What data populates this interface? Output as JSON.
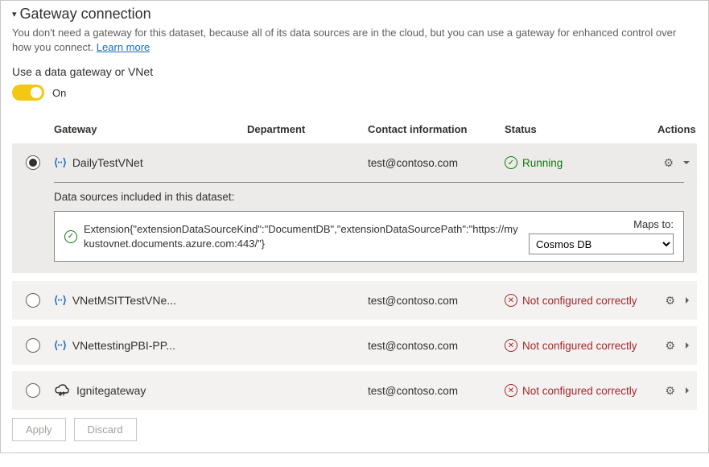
{
  "header": {
    "title": "Gateway connection",
    "description": "You don't need a gateway for this dataset, because all of its data sources are in the cloud, but you can use a gateway for enhanced control over how you connect. ",
    "learn_more": "Learn more"
  },
  "toggle": {
    "section_label": "Use a data gateway or VNet",
    "on_label": "On",
    "state": "on"
  },
  "columns": {
    "gateway": "Gateway",
    "department": "Department",
    "contact": "Contact information",
    "status": "Status",
    "actions": "Actions"
  },
  "gateways": [
    {
      "name": "DailyTestVNet",
      "type": "vnet",
      "department": "",
      "contact": "test@contoso.com",
      "status_text": "Running",
      "status_kind": "ok",
      "selected": true,
      "expanded": true
    },
    {
      "name": "VNetMSITTestVNe...",
      "type": "vnet",
      "department": "",
      "contact": "test@contoso.com",
      "status_text": "Not configured correctly",
      "status_kind": "bad",
      "selected": false,
      "expanded": false
    },
    {
      "name": "VNettestingPBI-PP...",
      "type": "vnet",
      "department": "",
      "contact": "test@contoso.com",
      "status_text": "Not configured correctly",
      "status_kind": "bad",
      "selected": false,
      "expanded": false
    },
    {
      "name": "Ignitegateway",
      "type": "onprem",
      "department": "",
      "contact": "test@contoso.com",
      "status_text": "Not configured correctly",
      "status_kind": "bad",
      "selected": false,
      "expanded": false
    }
  ],
  "datasource": {
    "header": "Data sources included in this dataset:",
    "text": "Extension{\"extensionDataSourceKind\":\"DocumentDB\",\"extensionDataSourcePath\":\"https://mykustovnet.documents.azure.com:443/\"}",
    "maps_label": "Maps to:",
    "maps_value": "Cosmos DB"
  },
  "buttons": {
    "apply": "Apply",
    "discard": "Discard"
  }
}
